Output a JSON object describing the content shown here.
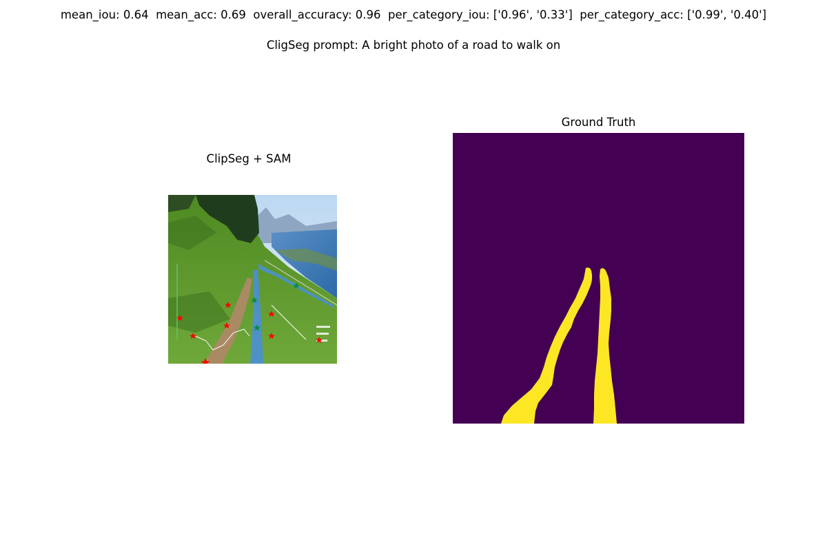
{
  "header": {
    "metrics_line": "mean_iou: 0.64  mean_acc: 0.69  overall_accuracy: 0.96  per_category_iou: ['0.96', '0.33']  per_category_acc: ['0.99', '0.40']",
    "prompt_line": "CligSeg prompt: A bright photo of a road to walk on"
  },
  "panels": {
    "left_title": "ClipSeg + SAM",
    "right_title": "Ground Truth"
  },
  "colors": {
    "gt_background": "#440154",
    "gt_foreground": "#fde725",
    "mask_overlay": "#4a8fd6",
    "positive_point": "#0a8a3a",
    "negative_point": "#ff0000"
  }
}
